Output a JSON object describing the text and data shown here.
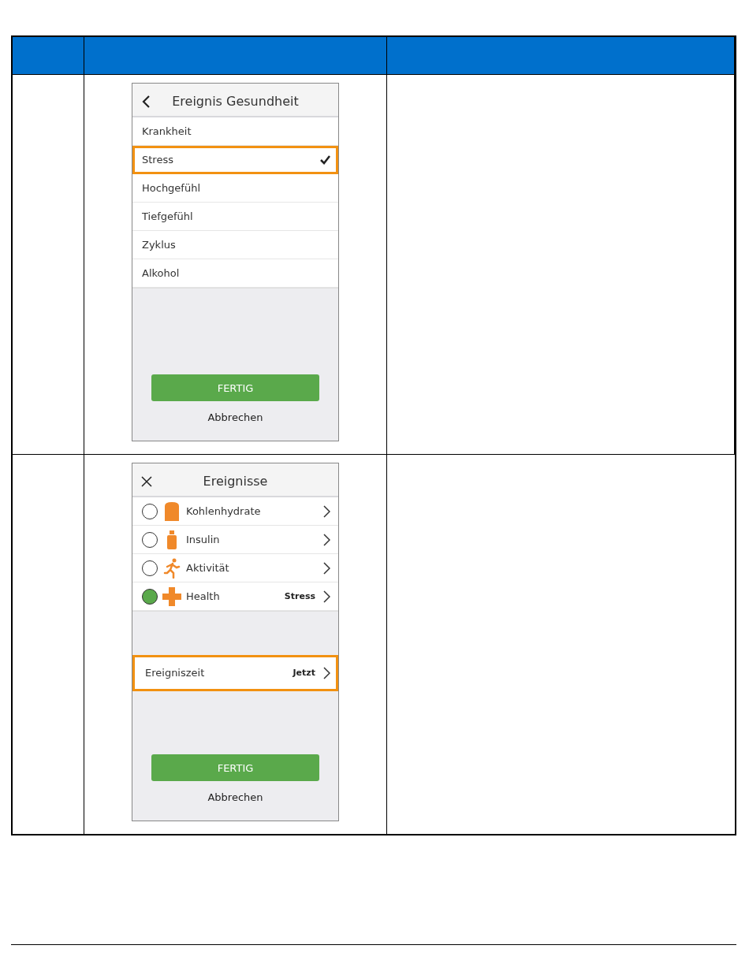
{
  "table": {
    "rows": [
      {
        "screen": {
          "kind": "list",
          "title": "Ereignis Gesundheit",
          "items": [
            {
              "label": "Krankheit",
              "selected": false,
              "highlighted": false
            },
            {
              "label": "Stress",
              "selected": true,
              "highlighted": true
            },
            {
              "label": "Hochgefühl",
              "selected": false,
              "highlighted": false
            },
            {
              "label": "Tiefgefühl",
              "selected": false,
              "highlighted": false
            },
            {
              "label": "Zyklus",
              "selected": false,
              "highlighted": false
            },
            {
              "label": "Alkohol",
              "selected": false,
              "highlighted": false
            }
          ],
          "done_button": "FERTIG",
          "cancel_link": "Abbrechen"
        }
      },
      {
        "screen": {
          "kind": "events",
          "title": "Ereignisse",
          "items": [
            {
              "kind": "carbs",
              "label": "Kohlenhydrate",
              "selected": false
            },
            {
              "kind": "insulin",
              "label": "Insulin",
              "selected": false
            },
            {
              "kind": "activity",
              "label": "Aktivität",
              "selected": false
            },
            {
              "kind": "health",
              "label": "Health",
              "value": "Stress",
              "selected": true
            }
          ],
          "time_row": {
            "label": "Ereigniszeit",
            "value": "Jetzt",
            "highlighted": true
          },
          "done_button": "FERTIG",
          "cancel_link": "Abbrechen"
        }
      }
    ]
  }
}
